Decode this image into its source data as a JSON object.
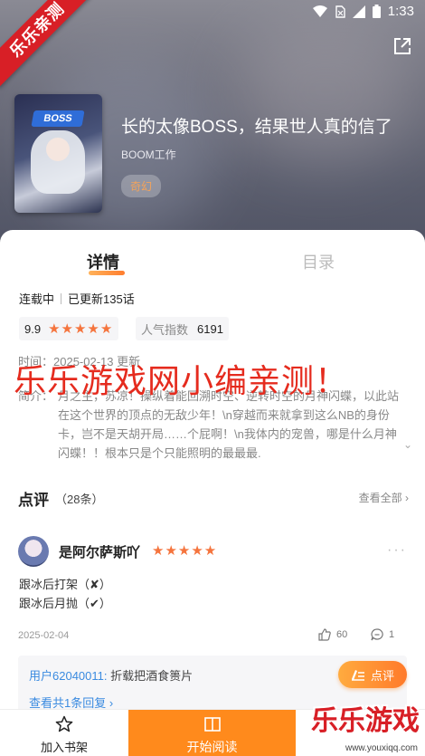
{
  "status_bar": {
    "time": "1:33"
  },
  "ribbon": {
    "text": "乐乐亲测"
  },
  "book": {
    "title": "长的太像BOSS，结果世人真的信了",
    "author": "BOOM工作",
    "genre": "奇幻",
    "cover_logo": "BOSS"
  },
  "tabs": [
    {
      "label": "详情",
      "active": true
    },
    {
      "label": "目录",
      "active": false
    }
  ],
  "detail": {
    "status": "连载中",
    "updated": "已更新135话",
    "rating": "9.9",
    "rating_stars": 5,
    "popularity_label": "人气指数",
    "popularity_value": "6191",
    "update_time": "时间：2025-02-13 更新",
    "intro_label": "简介：",
    "intro_text": "月之主，苏凉！操纵着能回溯时空、逆转时空的月神闪蝶，以此站在这个世界的顶点的无敌少年！\\n穿越而来就拿到这么NB的身份卡，岂不是天胡开局……个屁啊！\\n我体内的宠兽，哪是什么月神闪蝶！！根本只是个只能照明的最最最."
  },
  "watermark_overlay": "乐乐游戏网小编亲测！",
  "reviews": {
    "title": "点评",
    "count": "（28条）",
    "view_all": "查看全部",
    "items": [
      {
        "user": "是阿尔萨斯吖",
        "stars": 5,
        "lines": [
          "跟冰后打架（✘）",
          "跟冰后月抛（✔）"
        ],
        "date": "2025-02-04",
        "likes": "60",
        "replies": "1",
        "reply_user": "用户62040011:",
        "reply_text": " 折载把酒食篑片",
        "reply_view": "查看共1条回复 ›"
      }
    ],
    "comment_button": "点评"
  },
  "bottom_bar": {
    "add_shelf": "加入书架",
    "start_reading": "开始阅读"
  },
  "site_logo": {
    "text": "乐乐游戏",
    "url": "www.youxiqq.com"
  }
}
